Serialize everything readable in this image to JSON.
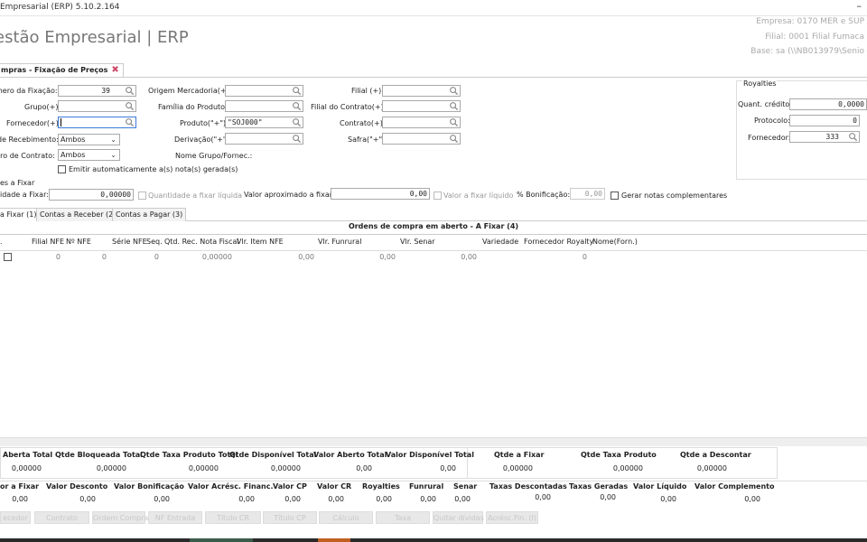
{
  "window": {
    "title": "Empresarial (ERP) 5.10.2.164",
    "minimize": "–"
  },
  "app": {
    "title": "estão Empresarial | ERP"
  },
  "info": {
    "empresa": "Empresa: 0170 MER e SUP",
    "filial": "Filial: 0001 Filial Fumaca",
    "base": "Base: sa (\\\\NB013979\\Senio"
  },
  "tab": {
    "label": "mpras - Fixação de Preços",
    "close": "✖"
  },
  "form": {
    "numero_label": "mero da Fixação:",
    "numero_value": "39",
    "grupo_label": "Grupo(+):",
    "grupo_value": "",
    "fornecedor_label": "Fornecedor(+):",
    "fornecedor_value": "",
    "recebimento_label": "de Recebimento:",
    "recebimento_value": "Ambos",
    "contrato_tipo_label": "tro de Contrato:",
    "contrato_tipo_value": "Ambos",
    "origem_label": "Origem Mercadoria(+):",
    "origem_value": "",
    "familia_label": "Família do Produto:",
    "familia_value": "",
    "produto_label": "Produto(\"+\"):",
    "produto_value": "\"SOJ000\"",
    "derivacao_label": "Derivação(\"+\"):",
    "derivacao_value": "",
    "nome_grupo_label": "Nome Grupo/Fornec.:",
    "filial_label": "Filial (+):",
    "filial_value": "",
    "filial_contrato_label": "Filial do Contrato(+):",
    "filial_contrato_value": "",
    "contrato_label": "Contrato(+):",
    "contrato_value": "",
    "safra_label": "Safra(\"+\"):",
    "safra_value": "",
    "emitir_label": "Emitir automaticamente a(s) nota(s) gerada(s)"
  },
  "royalties": {
    "title": "Royalties",
    "quant_label": "Quant. crédito:",
    "quant_value": "0,0000",
    "protocolo_label": "Protocolo:",
    "protocolo_value": "0",
    "fornecedor_label": "Fornecedor:",
    "fornecedor_value": "333"
  },
  "fixar": {
    "section": "es a Fixar",
    "qtd_label": "idade a Fixar:",
    "qtd_value": "0,00000",
    "qtd_liq_label": "Quantidade a fixar líquida",
    "valor_label": "Valor aproximado a fixar:",
    "valor_value": "0,00",
    "valor_liq_label": "Valor a fixar líquido",
    "bonif_label": "% Bonificação:",
    "bonif_value": "0,00",
    "gerar_label": "Gerar notas complementares"
  },
  "subtabs": [
    "a Fixar (1)",
    "Contas a Receber (2)",
    "Contas a Pagar (3)"
  ],
  "grid": {
    "title": "Ordens de compra em aberto - A Fixar (4)",
    "headers": [
      ".",
      "Filial NFE",
      "Nº NFE",
      "Série NFE",
      "Seq.",
      "Qtd. Rec. Nota Fiscal",
      "Vlr. Item NFE",
      "Vlr. Funrural",
      "Vlr. Senar",
      "Variedade",
      "Fornecedor Royalty",
      "Nome(Forn.)"
    ],
    "row": [
      "0",
      "0",
      "0",
      "0,00000",
      "0,00",
      "0,00",
      "0,00",
      "0"
    ]
  },
  "totals1": {
    "headers": [
      "Aberta Total",
      "Qtde Bloqueada Total",
      "Qtde Taxa Produto Total",
      "Qtde Disponível Total",
      "Valor Aberto Total",
      "Valor Disponível Total"
    ],
    "values": [
      "0,00000",
      "0,00000",
      "0,00000",
      "0,00000",
      "0,00",
      "0,00"
    ]
  },
  "totals2": {
    "headers": [
      "Qtde a Fixar",
      "Qtde Taxa Produto",
      "Qtde a Descontar"
    ],
    "values": [
      "0,00000",
      "0,00000",
      "0,00000"
    ]
  },
  "totals3": {
    "headers": [
      "or a Fixar",
      "Valor Desconto",
      "Valor Bonificação",
      "Valor Acrésc. Financ.",
      "Valor CP",
      "Valor CR",
      "Royalties",
      "Funrural",
      "Senar",
      "Taxas Descontadas",
      "Taxas Geradas",
      "Valor Líquido",
      "Valor Complemento"
    ],
    "values": [
      "0,00",
      "0,00",
      "0,00",
      "0,00",
      "0,00",
      "0,00",
      "0,00",
      "0,00",
      "0,00",
      "0,00",
      "0,00",
      "0,00",
      "0,00"
    ]
  },
  "buttons": [
    "ecedor",
    "Contrato",
    "Ordem Compra",
    "NF Entrada",
    "Título CR",
    "Título CP",
    "Cálculo",
    "Taxa",
    "Quitar dívidas",
    "Acrésc.Fin. (I)"
  ],
  "icons": {
    "lookup": "search-icon",
    "dropdown": "chevron-down-icon",
    "close": "close-icon"
  }
}
